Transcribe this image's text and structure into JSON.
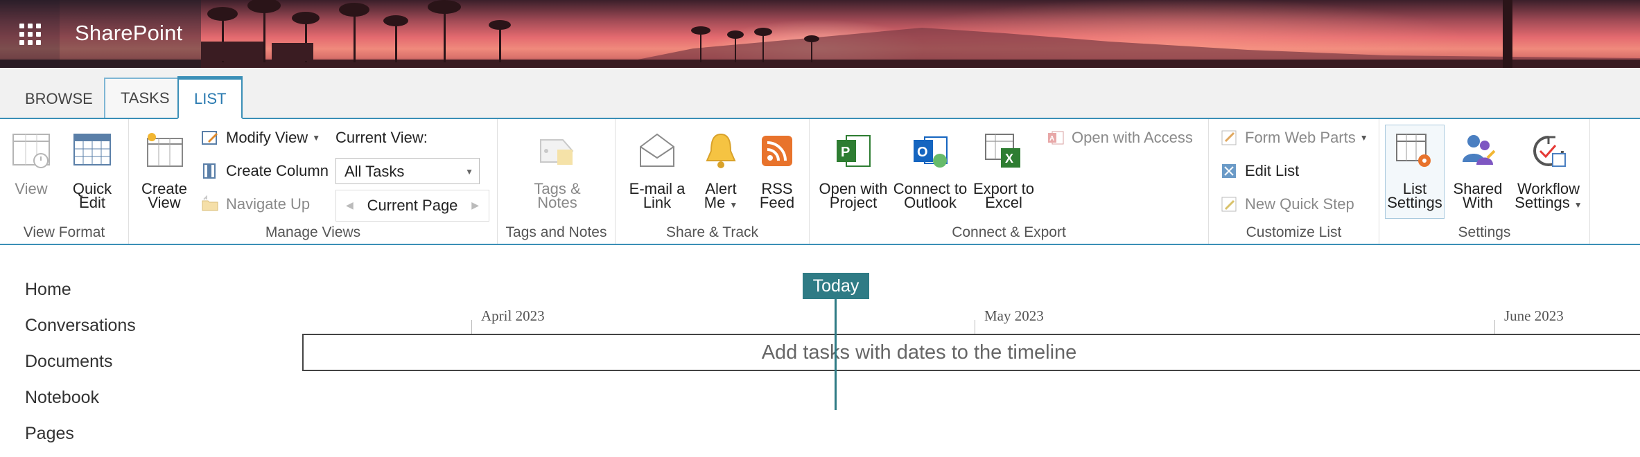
{
  "suite": {
    "brand": "SharePoint"
  },
  "tabs": [
    {
      "label": "BROWSE"
    },
    {
      "label": "TASKS"
    },
    {
      "label": "LIST"
    }
  ],
  "ribbon": {
    "view_format": {
      "label": "View Format",
      "view": "View",
      "quick_edit_1": "Quick",
      "quick_edit_2": "Edit"
    },
    "manage_views": {
      "label": "Manage Views",
      "create_view_1": "Create",
      "create_view_2": "View",
      "modify_view": "Modify View",
      "create_column": "Create Column",
      "navigate_up": "Navigate Up",
      "current_view_label": "Current View:",
      "current_view_value": "All Tasks",
      "current_page": "Current Page"
    },
    "tags_notes": {
      "label": "Tags and Notes",
      "btn_1": "Tags &",
      "btn_2": "Notes"
    },
    "share_track": {
      "label": "Share & Track",
      "email_1": "E-mail a",
      "email_2": "Link",
      "alert_1": "Alert",
      "alert_2": "Me",
      "rss_1": "RSS",
      "rss_2": "Feed"
    },
    "connect_export": {
      "label": "Connect & Export",
      "project_1": "Open with",
      "project_2": "Project",
      "outlook_1": "Connect to",
      "outlook_2": "Outlook",
      "excel_1": "Export to",
      "excel_2": "Excel",
      "access": "Open with Access"
    },
    "customize_list": {
      "label": "Customize List",
      "form_web_parts": "Form Web Parts",
      "edit_list": "Edit List",
      "new_quick_step": "New Quick Step"
    },
    "settings": {
      "label": "Settings",
      "list_settings_1": "List",
      "list_settings_2": "Settings",
      "shared_with_1": "Shared",
      "shared_with_2": "With",
      "workflow_1": "Workflow",
      "workflow_2": "Settings"
    }
  },
  "leftnav": {
    "items": [
      {
        "label": "Home"
      },
      {
        "label": "Conversations"
      },
      {
        "label": "Documents"
      },
      {
        "label": "Notebook"
      },
      {
        "label": "Pages"
      }
    ]
  },
  "timeline": {
    "today": "Today",
    "months": [
      "April 2023",
      "May 2023",
      "June 2023"
    ],
    "placeholder": "Add tasks with dates to the timeline"
  },
  "colors": {
    "accent": "#3a8fb7",
    "today": "#2f7b85"
  }
}
